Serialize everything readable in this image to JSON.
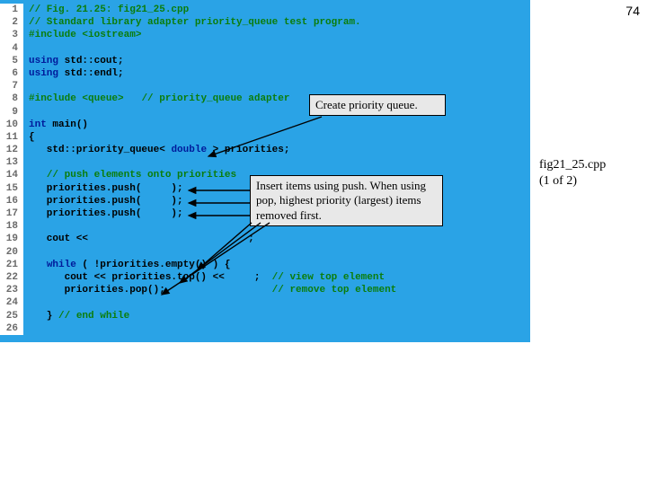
{
  "page_number": "74",
  "caption": {
    "line1": "fig21_25.cpp",
    "line2": "(1 of 2)"
  },
  "callouts": {
    "c1": "Create priority queue.",
    "c2": "Insert items using push. When using pop, highest priority (largest) items removed first."
  },
  "code": {
    "lines": [
      {
        "n": "1",
        "segs": [
          {
            "c": "t-comment",
            "t": "// Fig. 21.25: fig21_25.cpp"
          }
        ]
      },
      {
        "n": "2",
        "segs": [
          {
            "c": "t-comment",
            "t": "// Standard library adapter priority_queue test program."
          }
        ]
      },
      {
        "n": "3",
        "segs": [
          {
            "c": "t-pre",
            "t": "#include <iostream>"
          }
        ]
      },
      {
        "n": "4",
        "segs": [
          {
            "c": "t-plain",
            "t": ""
          }
        ]
      },
      {
        "n": "5",
        "segs": [
          {
            "c": "t-kw",
            "t": "using"
          },
          {
            "c": "t-plain",
            "t": " std::cout;"
          }
        ]
      },
      {
        "n": "6",
        "segs": [
          {
            "c": "t-kw",
            "t": "using"
          },
          {
            "c": "t-plain",
            "t": " std::endl;"
          }
        ]
      },
      {
        "n": "7",
        "segs": [
          {
            "c": "t-plain",
            "t": ""
          }
        ]
      },
      {
        "n": "8",
        "segs": [
          {
            "c": "t-pre",
            "t": "#include <queue>"
          },
          {
            "c": "t-plain",
            "t": "   "
          },
          {
            "c": "t-comment",
            "t": "// priority_queue adapter"
          }
        ]
      },
      {
        "n": "9",
        "segs": [
          {
            "c": "t-plain",
            "t": ""
          }
        ]
      },
      {
        "n": "10",
        "segs": [
          {
            "c": "t-kw",
            "t": "int"
          },
          {
            "c": "t-plain",
            "t": " main()"
          }
        ]
      },
      {
        "n": "11",
        "segs": [
          {
            "c": "t-plain",
            "t": "{"
          }
        ]
      },
      {
        "n": "12",
        "segs": [
          {
            "c": "t-plain",
            "t": "   std::priority_queue< "
          },
          {
            "c": "t-kw",
            "t": "double"
          },
          {
            "c": "t-plain",
            "t": " > priorities;"
          }
        ]
      },
      {
        "n": "13",
        "segs": [
          {
            "c": "t-plain",
            "t": ""
          }
        ]
      },
      {
        "n": "14",
        "segs": [
          {
            "c": "t-plain",
            "t": "   "
          },
          {
            "c": "t-comment",
            "t": "// push elements onto priorities"
          }
        ]
      },
      {
        "n": "15",
        "segs": [
          {
            "c": "t-plain",
            "t": "   priorities.push(     );"
          }
        ]
      },
      {
        "n": "16",
        "segs": [
          {
            "c": "t-plain",
            "t": "   priorities.push(     );"
          }
        ]
      },
      {
        "n": "17",
        "segs": [
          {
            "c": "t-plain",
            "t": "   priorities.push(     );"
          }
        ]
      },
      {
        "n": "18",
        "segs": [
          {
            "c": "t-plain",
            "t": ""
          }
        ]
      },
      {
        "n": "19",
        "segs": [
          {
            "c": "t-plain",
            "t": "   cout <<                           ;"
          }
        ]
      },
      {
        "n": "20",
        "segs": [
          {
            "c": "t-plain",
            "t": ""
          }
        ]
      },
      {
        "n": "21",
        "segs": [
          {
            "c": "t-plain",
            "t": "   "
          },
          {
            "c": "t-kw",
            "t": "while"
          },
          {
            "c": "t-plain",
            "t": " ( !priorities.empty() ) {"
          }
        ]
      },
      {
        "n": "22",
        "segs": [
          {
            "c": "t-plain",
            "t": "      cout << priorities.top() <<     ;  "
          },
          {
            "c": "t-comment",
            "t": "// view top element"
          }
        ]
      },
      {
        "n": "23",
        "segs": [
          {
            "c": "t-plain",
            "t": "      priorities.pop();                  "
          },
          {
            "c": "t-comment",
            "t": "// remove top element"
          }
        ]
      },
      {
        "n": "24",
        "segs": [
          {
            "c": "t-plain",
            "t": ""
          }
        ]
      },
      {
        "n": "25",
        "segs": [
          {
            "c": "t-plain",
            "t": "   } "
          },
          {
            "c": "t-comment",
            "t": "// end while"
          }
        ]
      },
      {
        "n": "26",
        "segs": [
          {
            "c": "t-plain",
            "t": ""
          }
        ]
      }
    ]
  }
}
